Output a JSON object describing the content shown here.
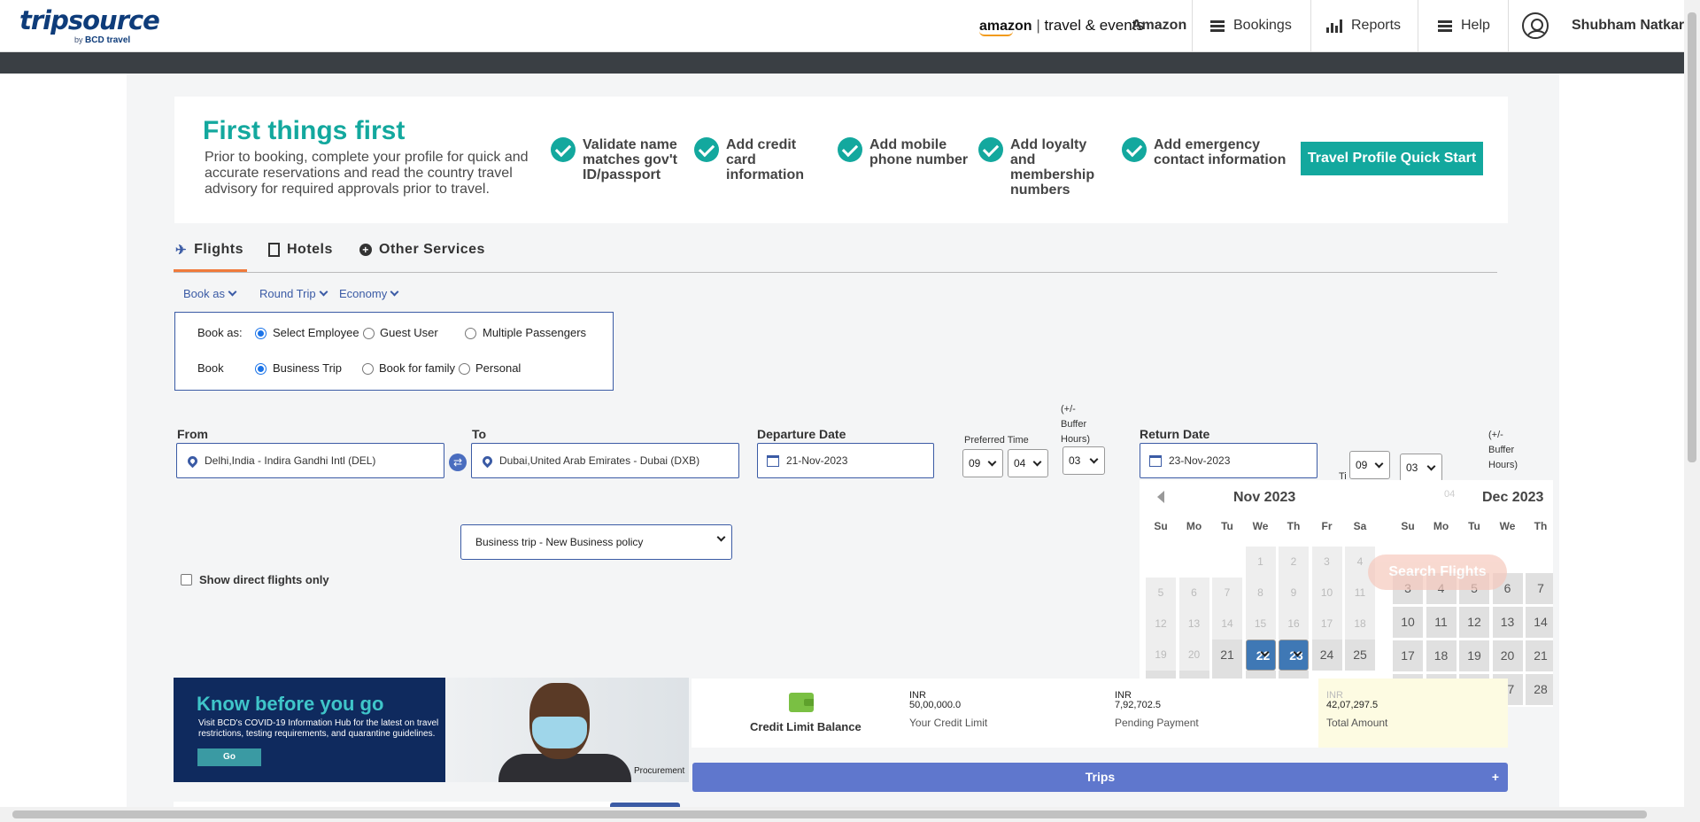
{
  "header": {
    "logo_main": "tripsource",
    "logo_by": "by",
    "logo_sub": "BCD travel",
    "amazon_word": "amazon",
    "amazon_tagline": "travel & events",
    "company": "Amazon",
    "nav": [
      {
        "label": "Bookings",
        "icon": "menu-icon"
      },
      {
        "label": "Reports",
        "icon": "bar-chart-icon"
      },
      {
        "label": "Help",
        "icon": "menu-icon"
      }
    ],
    "user": "Shubham Natkar"
  },
  "banner": {
    "title": "First things first",
    "description": "Prior to booking, complete your profile for quick and accurate reservations and read the country travel advisory for required approvals prior to travel.",
    "checks": [
      "Validate name matches gov't ID/passport",
      "Add credit card information",
      "Add mobile phone number",
      "Add loyalty and membership numbers",
      "Add emergency contact information"
    ],
    "cta": "Travel Profile Quick Start"
  },
  "tabs": [
    {
      "label": "Flights",
      "icon": "plane-icon",
      "active": true
    },
    {
      "label": "Hotels",
      "icon": "building-icon",
      "active": false
    },
    {
      "label": "Other Services",
      "icon": "plus-circle-icon",
      "active": false
    }
  ],
  "dropdowns": {
    "book_as": "Book as",
    "trip_type": "Round Trip",
    "cabin": "Economy"
  },
  "book_box": {
    "row1_label": "Book as:",
    "row1_options": [
      "Select Employee",
      "Guest User",
      "Multiple Passengers"
    ],
    "row2_label": "Book",
    "row2_options": [
      "Business Trip",
      "Book for family",
      "Personal"
    ]
  },
  "search": {
    "from_label": "From",
    "from_value": "Delhi,India - Indira Gandhi Intl (DEL)",
    "to_label": "To",
    "to_value": "Dubai,United Arab Emirates - Dubai  (DXB)",
    "departure_label": "Departure Date",
    "departure_value": "21-Nov-2023",
    "preferred_time_label": "Preferred Time",
    "dep_hour": "09",
    "dep_min": "04",
    "buffer_label_1": "(+/-",
    "buffer_label_2": "Buffer",
    "buffer_label_3": "Hours)",
    "dep_buffer": "03",
    "return_label": "Return Date",
    "return_value": "23-Nov-2023",
    "ret_time_partial": "Ti",
    "ret_hour": "09",
    "ret_min": "04",
    "ret_buffer": "03",
    "policy": "Business trip - New Business policy",
    "direct_only": "Show direct flights only",
    "search_button": "Search Flights"
  },
  "calendar": {
    "month1": "Nov 2023",
    "month2": "Dec 2023",
    "weekdays": [
      "Su",
      "Mo",
      "Tu",
      "We",
      "Th",
      "Fr",
      "Sa"
    ],
    "weekdays2": [
      "Su",
      "Mo",
      "Tu",
      "We",
      "Th"
    ],
    "selected": [
      "22",
      "23"
    ]
  },
  "know_before": {
    "title": "Know before you go",
    "desc": "Visit BCD's COVID-19 Information Hub for the latest on travel restrictions, testing requirements, and quarantine guidelines.",
    "go": "Go"
  },
  "credit": {
    "label": "Credit Limit Balance",
    "limit_currency": "INR",
    "limit_value": "50,00,000.0",
    "limit_label": "Your Credit Limit",
    "pending_currency": "INR",
    "pending_value": "7,92,702.5",
    "pending_label": "Pending Payment",
    "total_currency": "INR",
    "total_value": "42,07,297.5",
    "total_label": "Total Amount"
  },
  "procurement": "Procurement",
  "trips": {
    "label": "Trips",
    "toggle": "+"
  }
}
